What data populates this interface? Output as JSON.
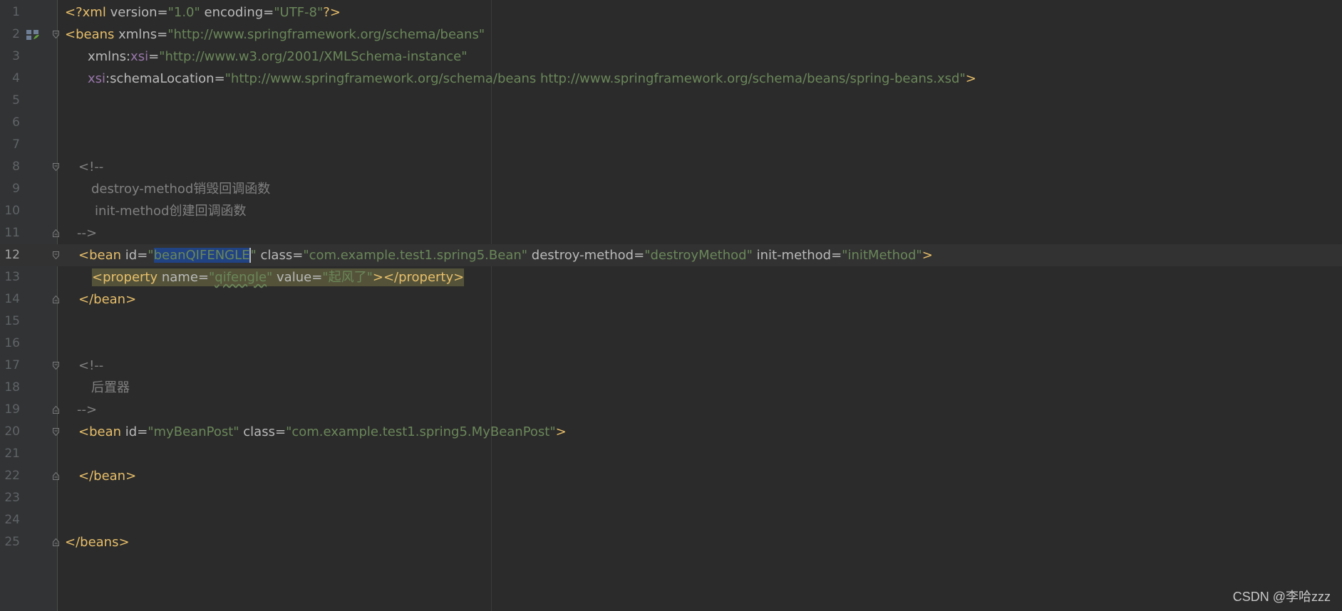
{
  "lines": [
    {
      "num": "1",
      "parts": [
        {
          "text": "<?",
          "cls": "t"
        },
        {
          "text": "xml ",
          "cls": "t"
        },
        {
          "text": "version",
          "cls": "a"
        },
        {
          "text": "=",
          "cls": "a"
        },
        {
          "text": "\"1.0\"",
          "cls": "v"
        },
        {
          "text": " encoding",
          "cls": "a"
        },
        {
          "text": "=",
          "cls": "a"
        },
        {
          "text": "\"UTF-8\"",
          "cls": "v"
        },
        {
          "text": "?>",
          "cls": "t"
        }
      ]
    },
    {
      "num": "2",
      "parts": [
        {
          "text": "<beans ",
          "cls": "t"
        },
        {
          "text": "xmlns",
          "cls": "a"
        },
        {
          "text": "=",
          "cls": "a"
        },
        {
          "text": "\"http://www.springframework.org/schema/beans\"",
          "cls": "v"
        }
      ]
    },
    {
      "num": "3",
      "parts": [
        {
          "text": "xmlns:",
          "cls": "a"
        },
        {
          "text": "xsi",
          "cls": "p"
        },
        {
          "text": "=",
          "cls": "a"
        },
        {
          "text": "\"http://www.w3.org/2001/XMLSchema-instance\"",
          "cls": "v"
        }
      ]
    },
    {
      "num": "4",
      "parts": [
        {
          "text": "xsi",
          "cls": "p"
        },
        {
          "text": ":schemaLocation",
          "cls": "a"
        },
        {
          "text": "=",
          "cls": "a"
        },
        {
          "text": "\"http://www.springframework.org/schema/beans http://www.springframework.org/schema/beans/spring-beans.xsd\"",
          "cls": "v"
        },
        {
          "text": ">",
          "cls": "t"
        }
      ]
    },
    {
      "num": "5",
      "parts": []
    },
    {
      "num": "6",
      "parts": []
    },
    {
      "num": "7",
      "parts": []
    },
    {
      "num": "8",
      "parts": [
        {
          "text": "<!--",
          "cls": "c"
        }
      ]
    },
    {
      "num": "9",
      "parts": [
        {
          "text": "destroy-method销毁回调函数",
          "cls": "c"
        }
      ]
    },
    {
      "num": "10",
      "parts": [
        {
          "text": "init-method创建回调函数",
          "cls": "c"
        }
      ]
    },
    {
      "num": "11",
      "parts": [
        {
          "text": "-->",
          "cls": "c"
        }
      ]
    },
    {
      "num": "12",
      "parts": [
        {
          "text": "<bean ",
          "cls": "t"
        },
        {
          "text": "id",
          "cls": "a"
        },
        {
          "text": "=",
          "cls": "a"
        },
        {
          "text": "\"",
          "cls": "v"
        },
        {
          "text": "beanQIFENGLE",
          "cls": "v sel"
        },
        {
          "text": "\"",
          "cls": "v caret"
        },
        {
          "text": " class",
          "cls": "a"
        },
        {
          "text": "=",
          "cls": "a"
        },
        {
          "text": "\"com.example.test1.spring5.Bean\"",
          "cls": "v"
        },
        {
          "text": " destroy-method",
          "cls": "a"
        },
        {
          "text": "=",
          "cls": "a"
        },
        {
          "text": "\"destroyMethod\"",
          "cls": "v"
        },
        {
          "text": " init-method",
          "cls": "a"
        },
        {
          "text": "=",
          "cls": "a"
        },
        {
          "text": "\"initMethod\"",
          "cls": "v"
        },
        {
          "text": ">",
          "cls": "t"
        }
      ]
    },
    {
      "num": "13",
      "parts": [
        {
          "text": "<property ",
          "cls": "t hlbox"
        },
        {
          "text": "name",
          "cls": "a hlbox"
        },
        {
          "text": "=",
          "cls": "a hlbox"
        },
        {
          "text": "\"",
          "cls": "v hlbox"
        },
        {
          "text": "qifengle",
          "cls": "v hlbox wavy"
        },
        {
          "text": "\"",
          "cls": "v hlbox"
        },
        {
          "text": " value",
          "cls": "a hlbox"
        },
        {
          "text": "=",
          "cls": "a hlbox"
        },
        {
          "text": "\"起风了\"",
          "cls": "v hlbox"
        },
        {
          "text": "></property>",
          "cls": "t hlbox"
        }
      ]
    },
    {
      "num": "14",
      "parts": [
        {
          "text": "</bean>",
          "cls": "t"
        }
      ]
    },
    {
      "num": "15",
      "parts": []
    },
    {
      "num": "16",
      "parts": []
    },
    {
      "num": "17",
      "parts": [
        {
          "text": "<!--",
          "cls": "c"
        }
      ]
    },
    {
      "num": "18",
      "parts": [
        {
          "text": "后置器",
          "cls": "c"
        }
      ]
    },
    {
      "num": "19",
      "parts": [
        {
          "text": "-->",
          "cls": "c"
        }
      ]
    },
    {
      "num": "20",
      "parts": [
        {
          "text": "<bean ",
          "cls": "t"
        },
        {
          "text": "id",
          "cls": "a"
        },
        {
          "text": "=",
          "cls": "a"
        },
        {
          "text": "\"myBeanPost\"",
          "cls": "v"
        },
        {
          "text": " class",
          "cls": "a"
        },
        {
          "text": "=",
          "cls": "a"
        },
        {
          "text": "\"com.example.test1.spring5.MyBeanPost\"",
          "cls": "v"
        },
        {
          "text": ">",
          "cls": "t"
        }
      ]
    },
    {
      "num": "21",
      "parts": []
    },
    {
      "num": "22",
      "parts": [
        {
          "text": "</bean>",
          "cls": "t"
        }
      ]
    },
    {
      "num": "23",
      "parts": []
    },
    {
      "num": "24",
      "parts": []
    },
    {
      "num": "25",
      "parts": [
        {
          "text": "</beans>",
          "cls": "t"
        }
      ]
    }
  ],
  "watermark": "CSDN @李哈zzz"
}
